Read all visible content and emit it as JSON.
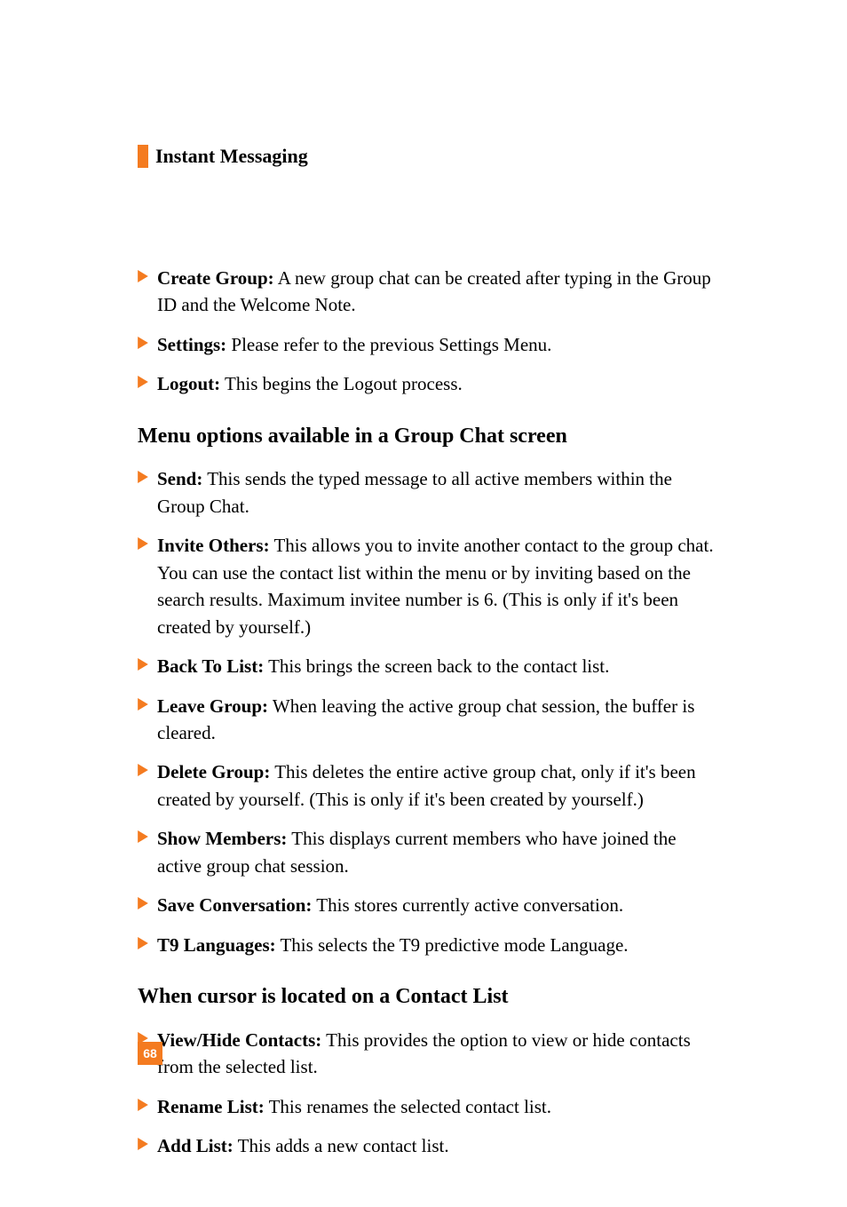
{
  "section_title": "Instant Messaging",
  "list1": [
    {
      "label": "Create Group:",
      "text": " A new group chat can be created after typing in the Group ID and the Welcome Note."
    },
    {
      "label": "Settings:",
      "text": " Please refer to the previous Settings Menu."
    },
    {
      "label": "Logout:",
      "text": " This begins the Logout process."
    }
  ],
  "heading1": "Menu options available in a Group Chat screen",
  "list2": [
    {
      "label": "Send:",
      "text": " This sends the typed message to all active members within the Group Chat."
    },
    {
      "label": "Invite Others:",
      "text": " This allows you to invite another contact to the group chat. You can use the contact list within the menu or by inviting based on the search results. Maximum invitee number is 6. (This is only if it's been created by yourself.)"
    },
    {
      "label": "Back To List:",
      "text": " This brings the screen back to the contact list."
    },
    {
      "label": "Leave Group:",
      "text": " When leaving the active group chat session, the buffer is cleared."
    },
    {
      "label": "Delete Group:",
      "text": " This deletes the entire active group chat, only if it's been created by yourself. (This is only if it's been created by yourself.)"
    },
    {
      "label": "Show Members:",
      "text": " This displays current members who have joined the active group chat session."
    },
    {
      "label": "Save Conversation:",
      "text": " This stores currently active conversation."
    },
    {
      "label": "T9 Languages:",
      "text": " This selects the T9 predictive mode Language."
    }
  ],
  "heading2": "When cursor is located on a Contact List",
  "list3": [
    {
      "label": "View/Hide Contacts:",
      "text": " This provides the option to view or hide contacts from the selected list."
    },
    {
      "label": "Rename List:",
      "text": " This renames the selected contact list."
    },
    {
      "label": "Add List:",
      "text": " This adds a new contact list."
    }
  ],
  "page_number": "68",
  "arrow_color": "#f47b20"
}
